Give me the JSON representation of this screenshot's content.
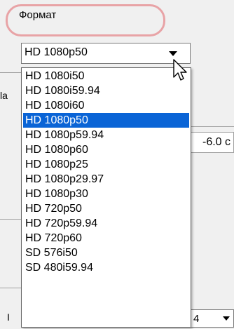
{
  "format_section": {
    "label": "Формат"
  },
  "format_combo": {
    "selected_value": "HD 1080p50"
  },
  "dropdown": {
    "options": [
      "HD 1080i50",
      "HD 1080i59.94",
      "HD 1080i60",
      "HD 1080p50",
      "HD 1080p59.94",
      "HD 1080p60",
      "HD 1080p25",
      "HD 1080p29.97",
      "HD 1080p30",
      "HD 720p50",
      "HD 720p59.94",
      "HD 720p60",
      "SD 576i50",
      "SD 480i59.94"
    ],
    "selected_index": 3
  },
  "background": {
    "left_fragment_1": "la",
    "left_fragment_2": "I",
    "value_fragment": "-6.0 c",
    "bottom_fragment": "4"
  }
}
